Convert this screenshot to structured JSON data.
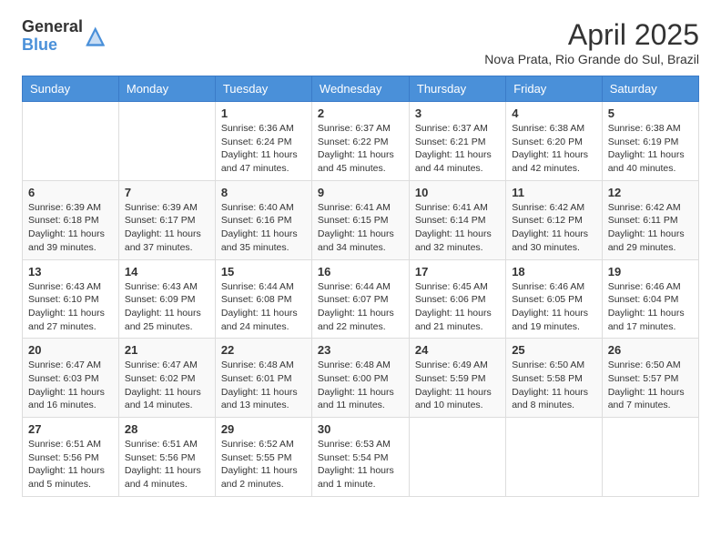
{
  "logo": {
    "general": "General",
    "blue": "Blue"
  },
  "title": "April 2025",
  "subtitle": "Nova Prata, Rio Grande do Sul, Brazil",
  "days_of_week": [
    "Sunday",
    "Monday",
    "Tuesday",
    "Wednesday",
    "Thursday",
    "Friday",
    "Saturday"
  ],
  "weeks": [
    [
      {
        "day": "",
        "info": ""
      },
      {
        "day": "",
        "info": ""
      },
      {
        "day": "1",
        "info": "Sunrise: 6:36 AM\nSunset: 6:24 PM\nDaylight: 11 hours and 47 minutes."
      },
      {
        "day": "2",
        "info": "Sunrise: 6:37 AM\nSunset: 6:22 PM\nDaylight: 11 hours and 45 minutes."
      },
      {
        "day": "3",
        "info": "Sunrise: 6:37 AM\nSunset: 6:21 PM\nDaylight: 11 hours and 44 minutes."
      },
      {
        "day": "4",
        "info": "Sunrise: 6:38 AM\nSunset: 6:20 PM\nDaylight: 11 hours and 42 minutes."
      },
      {
        "day": "5",
        "info": "Sunrise: 6:38 AM\nSunset: 6:19 PM\nDaylight: 11 hours and 40 minutes."
      }
    ],
    [
      {
        "day": "6",
        "info": "Sunrise: 6:39 AM\nSunset: 6:18 PM\nDaylight: 11 hours and 39 minutes."
      },
      {
        "day": "7",
        "info": "Sunrise: 6:39 AM\nSunset: 6:17 PM\nDaylight: 11 hours and 37 minutes."
      },
      {
        "day": "8",
        "info": "Sunrise: 6:40 AM\nSunset: 6:16 PM\nDaylight: 11 hours and 35 minutes."
      },
      {
        "day": "9",
        "info": "Sunrise: 6:41 AM\nSunset: 6:15 PM\nDaylight: 11 hours and 34 minutes."
      },
      {
        "day": "10",
        "info": "Sunrise: 6:41 AM\nSunset: 6:14 PM\nDaylight: 11 hours and 32 minutes."
      },
      {
        "day": "11",
        "info": "Sunrise: 6:42 AM\nSunset: 6:12 PM\nDaylight: 11 hours and 30 minutes."
      },
      {
        "day": "12",
        "info": "Sunrise: 6:42 AM\nSunset: 6:11 PM\nDaylight: 11 hours and 29 minutes."
      }
    ],
    [
      {
        "day": "13",
        "info": "Sunrise: 6:43 AM\nSunset: 6:10 PM\nDaylight: 11 hours and 27 minutes."
      },
      {
        "day": "14",
        "info": "Sunrise: 6:43 AM\nSunset: 6:09 PM\nDaylight: 11 hours and 25 minutes."
      },
      {
        "day": "15",
        "info": "Sunrise: 6:44 AM\nSunset: 6:08 PM\nDaylight: 11 hours and 24 minutes."
      },
      {
        "day": "16",
        "info": "Sunrise: 6:44 AM\nSunset: 6:07 PM\nDaylight: 11 hours and 22 minutes."
      },
      {
        "day": "17",
        "info": "Sunrise: 6:45 AM\nSunset: 6:06 PM\nDaylight: 11 hours and 21 minutes."
      },
      {
        "day": "18",
        "info": "Sunrise: 6:46 AM\nSunset: 6:05 PM\nDaylight: 11 hours and 19 minutes."
      },
      {
        "day": "19",
        "info": "Sunrise: 6:46 AM\nSunset: 6:04 PM\nDaylight: 11 hours and 17 minutes."
      }
    ],
    [
      {
        "day": "20",
        "info": "Sunrise: 6:47 AM\nSunset: 6:03 PM\nDaylight: 11 hours and 16 minutes."
      },
      {
        "day": "21",
        "info": "Sunrise: 6:47 AM\nSunset: 6:02 PM\nDaylight: 11 hours and 14 minutes."
      },
      {
        "day": "22",
        "info": "Sunrise: 6:48 AM\nSunset: 6:01 PM\nDaylight: 11 hours and 13 minutes."
      },
      {
        "day": "23",
        "info": "Sunrise: 6:48 AM\nSunset: 6:00 PM\nDaylight: 11 hours and 11 minutes."
      },
      {
        "day": "24",
        "info": "Sunrise: 6:49 AM\nSunset: 5:59 PM\nDaylight: 11 hours and 10 minutes."
      },
      {
        "day": "25",
        "info": "Sunrise: 6:50 AM\nSunset: 5:58 PM\nDaylight: 11 hours and 8 minutes."
      },
      {
        "day": "26",
        "info": "Sunrise: 6:50 AM\nSunset: 5:57 PM\nDaylight: 11 hours and 7 minutes."
      }
    ],
    [
      {
        "day": "27",
        "info": "Sunrise: 6:51 AM\nSunset: 5:56 PM\nDaylight: 11 hours and 5 minutes."
      },
      {
        "day": "28",
        "info": "Sunrise: 6:51 AM\nSunset: 5:56 PM\nDaylight: 11 hours and 4 minutes."
      },
      {
        "day": "29",
        "info": "Sunrise: 6:52 AM\nSunset: 5:55 PM\nDaylight: 11 hours and 2 minutes."
      },
      {
        "day": "30",
        "info": "Sunrise: 6:53 AM\nSunset: 5:54 PM\nDaylight: 11 hours and 1 minute."
      },
      {
        "day": "",
        "info": ""
      },
      {
        "day": "",
        "info": ""
      },
      {
        "day": "",
        "info": ""
      }
    ]
  ]
}
